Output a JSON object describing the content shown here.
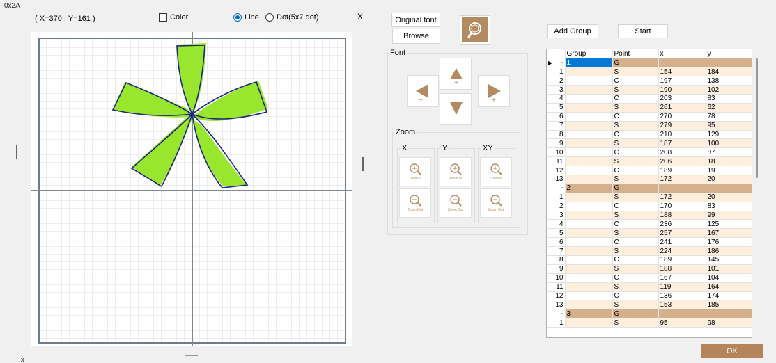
{
  "window": {
    "code": "0x2A",
    "bottom_glyph": "x"
  },
  "header": {
    "coords": "( X=370 , Y=161 )",
    "color_label": "Color",
    "mode_line_label": "Line",
    "mode_dot_label": "Dot(5x7 dot)",
    "close_glyph": "X"
  },
  "controls": {
    "original_font_label": "Original font",
    "browse_label": "Browse",
    "font_group_label": "Font",
    "zoom_group_label": "Zoom",
    "zoom_x": "X",
    "zoom_y": "Y",
    "zoom_xy": "XY",
    "zoom_in_label": "Zoom In",
    "zoom_out_label": "Zoom Out",
    "add_group_label": "Add Group",
    "start_label": "Start",
    "ok_label": "OK",
    "plus_glyph": "+",
    "minus_glyph": "−"
  },
  "colors": {
    "accent": "#b48a60",
    "glyph_fill": "#99e62e",
    "outline": "#1a237e",
    "selection": "#0078d7"
  },
  "grid": {
    "columns": [
      "Group",
      "Point",
      "x",
      "y"
    ],
    "rows": [
      {
        "rh": "-",
        "group": "1",
        "point": "G",
        "x": "",
        "y": "",
        "type": "g",
        "current": true
      },
      {
        "rh": "1",
        "group": "",
        "point": "S",
        "x": "154",
        "y": "184"
      },
      {
        "rh": "2",
        "group": "",
        "point": "C",
        "x": "197",
        "y": "138"
      },
      {
        "rh": "3",
        "group": "",
        "point": "S",
        "x": "190",
        "y": "102"
      },
      {
        "rh": "4",
        "group": "",
        "point": "C",
        "x": "203",
        "y": "83"
      },
      {
        "rh": "5",
        "group": "",
        "point": "S",
        "x": "261",
        "y": "62"
      },
      {
        "rh": "6",
        "group": "",
        "point": "C",
        "x": "270",
        "y": "78"
      },
      {
        "rh": "7",
        "group": "",
        "point": "S",
        "x": "279",
        "y": "95"
      },
      {
        "rh": "8",
        "group": "",
        "point": "C",
        "x": "210",
        "y": "129"
      },
      {
        "rh": "9",
        "group": "",
        "point": "S",
        "x": "187",
        "y": "100"
      },
      {
        "rh": "10",
        "group": "",
        "point": "C",
        "x": "208",
        "y": "87"
      },
      {
        "rh": "11",
        "group": "",
        "point": "S",
        "x": "206",
        "y": "18"
      },
      {
        "rh": "12",
        "group": "",
        "point": "C",
        "x": "189",
        "y": "19"
      },
      {
        "rh": "13",
        "group": "",
        "point": "S",
        "x": "172",
        "y": "20"
      },
      {
        "rh": "-",
        "group": "2",
        "point": "G",
        "x": "",
        "y": "",
        "type": "g"
      },
      {
        "rh": "1",
        "group": "",
        "point": "S",
        "x": "172",
        "y": "20"
      },
      {
        "rh": "2",
        "group": "",
        "point": "C",
        "x": "170",
        "y": "83"
      },
      {
        "rh": "3",
        "group": "",
        "point": "S",
        "x": "188",
        "y": "99"
      },
      {
        "rh": "4",
        "group": "",
        "point": "C",
        "x": "236",
        "y": "125"
      },
      {
        "rh": "5",
        "group": "",
        "point": "S",
        "x": "257",
        "y": "167"
      },
      {
        "rh": "6",
        "group": "",
        "point": "C",
        "x": "241",
        "y": "176"
      },
      {
        "rh": "7",
        "group": "",
        "point": "S",
        "x": "224",
        "y": "186"
      },
      {
        "rh": "8",
        "group": "",
        "point": "C",
        "x": "189",
        "y": "145"
      },
      {
        "rh": "9",
        "group": "",
        "point": "S",
        "x": "188",
        "y": "101"
      },
      {
        "rh": "10",
        "group": "",
        "point": "C",
        "x": "167",
        "y": "104"
      },
      {
        "rh": "11",
        "group": "",
        "point": "S",
        "x": "119",
        "y": "164"
      },
      {
        "rh": "12",
        "group": "",
        "point": "C",
        "x": "136",
        "y": "174"
      },
      {
        "rh": "13",
        "group": "",
        "point": "S",
        "x": "153",
        "y": "185"
      },
      {
        "rh": "-",
        "group": "3",
        "point": "G",
        "x": "",
        "y": "",
        "type": "g"
      },
      {
        "rh": "1",
        "group": "",
        "point": "S",
        "x": "95",
        "y": "98"
      }
    ]
  }
}
